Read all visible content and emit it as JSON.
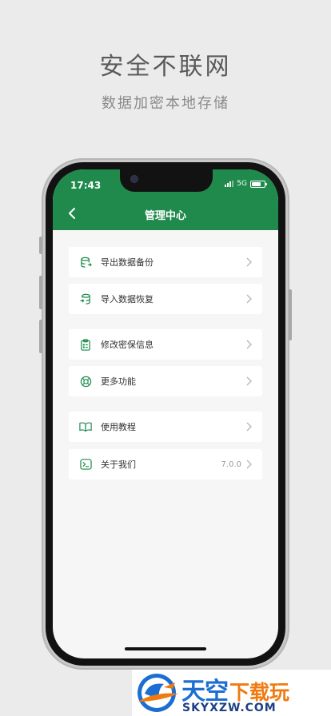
{
  "promo": {
    "headline": "安全不联网",
    "subline": "数据加密本地存储"
  },
  "status_bar": {
    "time": "17:43",
    "network": "5G"
  },
  "header": {
    "title": "管理中心",
    "bg_color": "#1f8a4c"
  },
  "menu": {
    "groups": [
      {
        "items": [
          {
            "label": "导出数据备份",
            "icon": "database-export-icon"
          },
          {
            "label": "导入数据恢复",
            "icon": "database-import-icon"
          }
        ]
      },
      {
        "items": [
          {
            "label": "修改密保信息",
            "icon": "clipboard-icon"
          },
          {
            "label": "更多功能",
            "icon": "lifebuoy-icon"
          }
        ]
      },
      {
        "items": [
          {
            "label": "使用教程",
            "icon": "book-icon"
          },
          {
            "label": "关于我们",
            "icon": "terminal-icon",
            "value": "7.0.0"
          }
        ]
      }
    ]
  },
  "watermark": {
    "cn_big": "天空",
    "cn_small": "下载玩",
    "en": "SKYXZW.COM"
  },
  "colors": {
    "accent": "#1f8a4c",
    "page_bg": "#ebebeb",
    "content_bg": "#f6f6f6"
  }
}
